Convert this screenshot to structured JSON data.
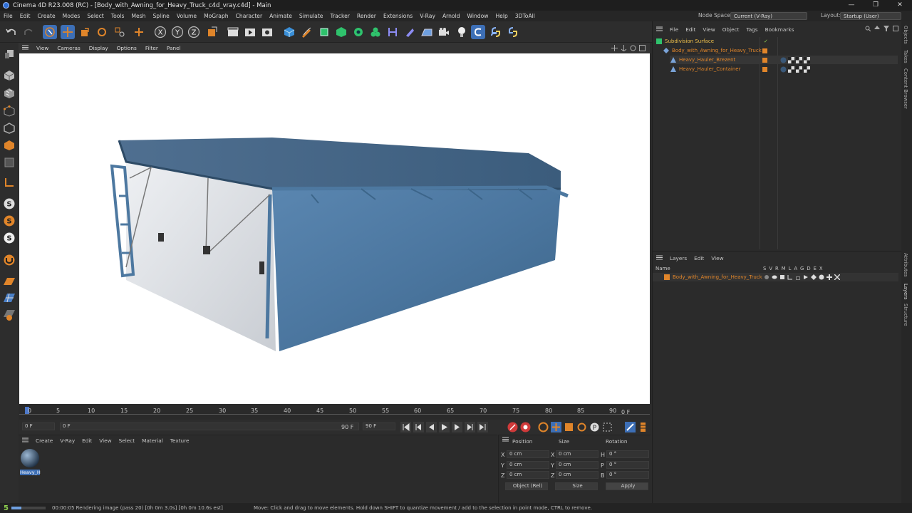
{
  "app": {
    "title": "Cinema 4D R23.008 (RC) - [Body_with_Awning_for_Heavy_Truck_c4d_vray.c4d] - Main"
  },
  "window_buttons": [
    "—",
    "❐",
    "✕"
  ],
  "menu": [
    "File",
    "Edit",
    "Create",
    "Modes",
    "Select",
    "Tools",
    "Mesh",
    "Spline",
    "Volume",
    "MoGraph",
    "Character",
    "Animate",
    "Simulate",
    "Tracker",
    "Render",
    "Extensions",
    "V-Ray",
    "Arnold",
    "Window",
    "Help",
    "3DToAll"
  ],
  "node_space": {
    "label": "Node Space:",
    "value": "Current (V-Ray)"
  },
  "layout": {
    "label": "Layout:",
    "value": "Startup (User)"
  },
  "viewport_menu": [
    "View",
    "Cameras",
    "Display",
    "Options",
    "Filter",
    "Panel"
  ],
  "timeline": {
    "ticks": [
      "0",
      "5",
      "10",
      "15",
      "20",
      "25",
      "30",
      "35",
      "40",
      "45",
      "50",
      "55",
      "60",
      "65",
      "70",
      "75",
      "80",
      "85",
      "90"
    ],
    "current": "0 F"
  },
  "transport": {
    "start": "0 F",
    "range_start": "0 F",
    "range_end": "90 F",
    "end": "90 F"
  },
  "material_menu": [
    "Create",
    "V-Ray",
    "Edit",
    "View",
    "Select",
    "Material",
    "Texture"
  ],
  "material": {
    "name": "Heavy_H"
  },
  "coords": {
    "headers": [
      "Position",
      "Size",
      "Rotation"
    ],
    "rows": [
      {
        "axis": "X",
        "pos": "0 cm",
        "size_axis": "X",
        "size": "0 cm",
        "rot_axis": "H",
        "rot": "0 °"
      },
      {
        "axis": "Y",
        "pos": "0 cm",
        "size_axis": "Y",
        "size": "0 cm",
        "rot_axis": "P",
        "rot": "0 °"
      },
      {
        "axis": "Z",
        "pos": "0 cm",
        "size_axis": "Z",
        "size": "0 cm",
        "rot_axis": "B",
        "rot": "0 °"
      }
    ],
    "mode": "Object (Rel)",
    "size_mode": "Size",
    "apply": "Apply"
  },
  "status": {
    "render": "00:00:05 Rendering image (pass 20) [0h  0m  3.0s] [0h  0m 10.6s est]",
    "hint": "Move: Click and drag to move elements. Hold down SHIFT to quantize movement / add to the selection in point mode, CTRL to remove."
  },
  "objects_menu": [
    "File",
    "Edit",
    "View",
    "Object",
    "Tags",
    "Bookmarks"
  ],
  "objects": [
    {
      "name": "Subdivision Surface"
    },
    {
      "name": "Body_with_Awning_for_Heavy_Truck"
    },
    {
      "name": "Heavy_Hauler_Brezent"
    },
    {
      "name": "Heavy_Hauler_Container"
    }
  ],
  "layers_menu": [
    "Layers",
    "Edit",
    "View"
  ],
  "layers_header": {
    "name": "Name",
    "cols": [
      "S",
      "V",
      "R",
      "M",
      "L",
      "A",
      "G",
      "D",
      "E",
      "X"
    ]
  },
  "layers": [
    {
      "name": "Body_with_Awning_for_Heavy_Truck"
    }
  ],
  "side_tabs": [
    "Objects",
    "Takes",
    "Content Browser",
    "Attributes",
    "Layers",
    "Structure"
  ],
  "colors": {
    "accent": "#e0852a",
    "selection": "#3d6fb6",
    "container": "#4d78a0",
    "awning": "#3f6688"
  }
}
